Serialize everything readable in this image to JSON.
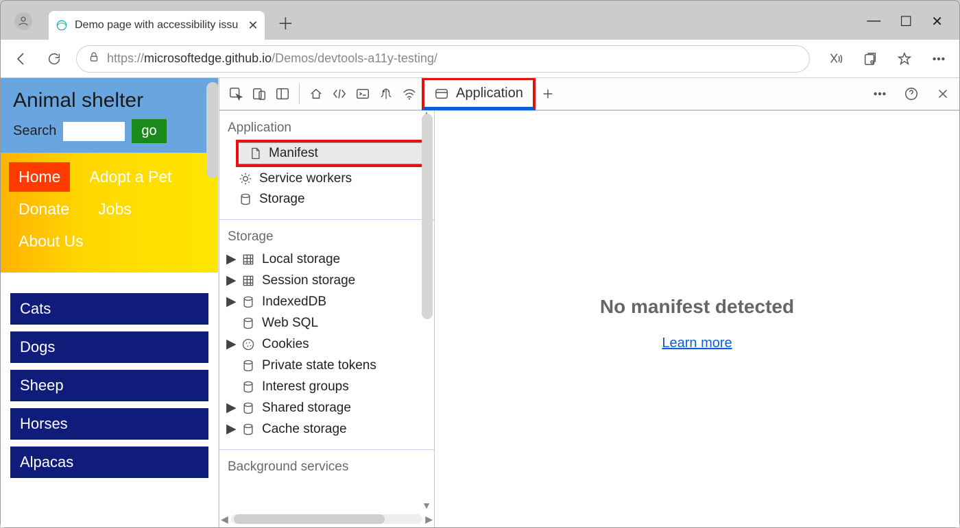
{
  "browser": {
    "tab_title": "Demo page with accessibility issu",
    "url_prefix": "https://",
    "url_host": "microsoftedge.github.io",
    "url_path": "/Demos/devtools-a11y-testing/"
  },
  "site": {
    "title": "Animal shelter",
    "search_label": "Search",
    "go_label": "go",
    "nav": {
      "home": "Home",
      "adopt": "Adopt a Pet",
      "donate": "Donate",
      "jobs": "Jobs",
      "about": "About Us"
    },
    "species": [
      "Cats",
      "Dogs",
      "Sheep",
      "Horses",
      "Alpacas"
    ]
  },
  "devtools": {
    "active_tab": "Application",
    "sections": {
      "application": {
        "title": "Application",
        "items": [
          "Manifest",
          "Service workers",
          "Storage"
        ]
      },
      "storage": {
        "title": "Storage",
        "items": [
          "Local storage",
          "Session storage",
          "IndexedDB",
          "Web SQL",
          "Cookies",
          "Private state tokens",
          "Interest groups",
          "Shared storage",
          "Cache storage"
        ]
      },
      "background": {
        "title": "Background services"
      }
    },
    "main": {
      "heading": "No manifest detected",
      "link": "Learn more"
    }
  }
}
